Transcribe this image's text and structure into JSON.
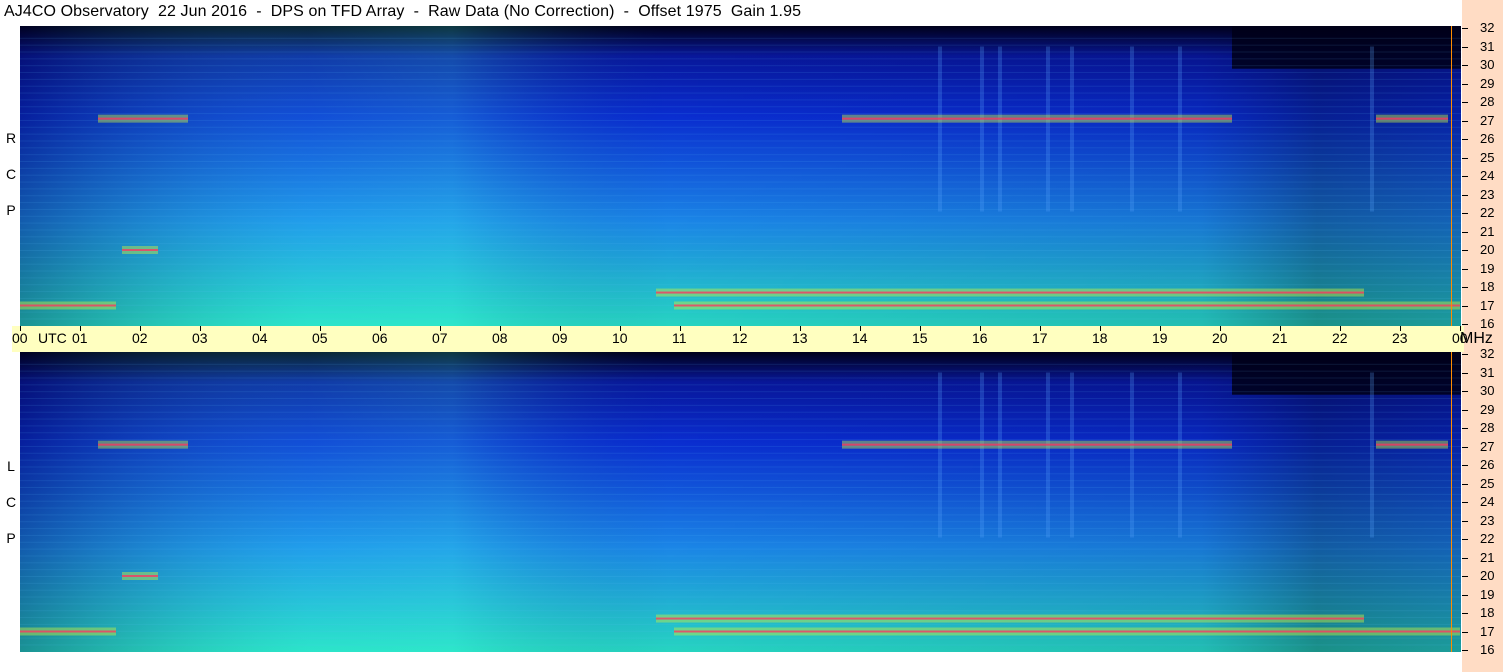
{
  "title": "AJ4CO Observatory  22 Jun 2016  -  DPS on TFD Array  -  Raw Data (No Correction)  -  Offset 1975  Gain 1.95",
  "panels": [
    {
      "id": "rcp",
      "label_letters": [
        "R",
        "C",
        "P"
      ]
    },
    {
      "id": "lcp",
      "label_letters": [
        "L",
        "C",
        "P"
      ]
    }
  ],
  "time_axis": {
    "ticks": [
      "00",
      "01",
      "02",
      "03",
      "04",
      "05",
      "06",
      "07",
      "08",
      "09",
      "10",
      "11",
      "12",
      "13",
      "14",
      "15",
      "16",
      "17",
      "18",
      "19",
      "20",
      "21",
      "22",
      "23",
      "00"
    ],
    "start_unit": "UTC",
    "end_unit": "MHz"
  },
  "freq_axis": {
    "ticks": [
      "32",
      "31",
      "30",
      "29",
      "28",
      "27",
      "26",
      "25",
      "24",
      "23",
      "22",
      "21",
      "20",
      "19",
      "18",
      "17",
      "16"
    ]
  },
  "colors": {
    "background_dark": "#000018",
    "low": "#0a2fd8",
    "mid": "#1c8cf0",
    "high": "#28e0c8",
    "band": "#c8f040",
    "hot": "#ff3060",
    "axis_bg": "#ffffc0",
    "side_bg": "#ffdcc4"
  },
  "chart_data": {
    "type": "heatmap",
    "title": "AJ4CO Observatory  22 Jun 2016  -  DPS on TFD Array  -  Raw Data (No Correction)  -  Offset 1975  Gain 1.95",
    "x_axis": {
      "unit": "UTC",
      "range": [
        0,
        24
      ],
      "tick_labels": [
        "00",
        "01",
        "02",
        "03",
        "04",
        "05",
        "06",
        "07",
        "08",
        "09",
        "10",
        "11",
        "12",
        "13",
        "14",
        "15",
        "16",
        "17",
        "18",
        "19",
        "20",
        "21",
        "22",
        "23",
        "00"
      ]
    },
    "y_axis": {
      "unit": "MHz",
      "range": [
        16,
        32
      ],
      "tick_labels": [
        "16",
        "17",
        "18",
        "19",
        "20",
        "21",
        "22",
        "23",
        "24",
        "25",
        "26",
        "27",
        "28",
        "29",
        "30",
        "31",
        "32"
      ]
    },
    "panels": [
      "RCP",
      "LCP"
    ],
    "bands": [
      {
        "freq_mhz": 27.1,
        "from_utc": 13.7,
        "to_utc": 20.2
      },
      {
        "freq_mhz": 27.1,
        "from_utc": 1.3,
        "to_utc": 2.8
      },
      {
        "freq_mhz": 27.1,
        "from_utc": 22.6,
        "to_utc": 23.8
      },
      {
        "freq_mhz": 17.7,
        "from_utc": 10.6,
        "to_utc": 22.4
      },
      {
        "freq_mhz": 17.0,
        "from_utc": 10.9,
        "to_utc": 24.0
      },
      {
        "freq_mhz": 17.0,
        "from_utc": 0.0,
        "to_utc": 1.6
      },
      {
        "freq_mhz": 20.0,
        "from_utc": 1.7,
        "to_utc": 2.3
      }
    ]
  }
}
